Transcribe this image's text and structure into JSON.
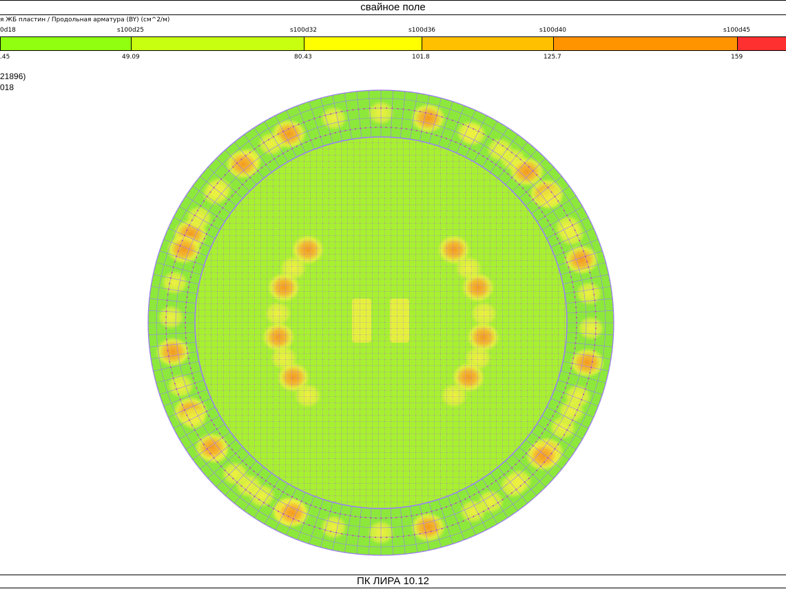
{
  "header": {
    "title": "свайное поле"
  },
  "legend": {
    "caption": "я ЖБ пластин / Продольная арматура (BY) (см^2/м)",
    "top_labels": [
      "0d18",
      "s100d25",
      "s100d32",
      "s100d36",
      "s100d40",
      "s100d45"
    ],
    "bottom_labels": [
      ".45",
      "49.09",
      "80.43",
      "101.8",
      "125.7",
      "159"
    ],
    "segment_colors": [
      "#90ff10",
      "#c8ff10",
      "#ffff00",
      "#ffc000",
      "#ff9300",
      "#ff3030"
    ]
  },
  "info": {
    "line1": "21896)",
    "line2": "018"
  },
  "plot": {
    "colors": {
      "base": "#8ce83a",
      "light": "#a8f030",
      "yellow": "#f0f040",
      "orange": "#f4a020",
      "mesh": "#9a7cff",
      "node": "#c040a0"
    }
  },
  "footer": {
    "label": "ПК ЛИРА 10.12"
  }
}
